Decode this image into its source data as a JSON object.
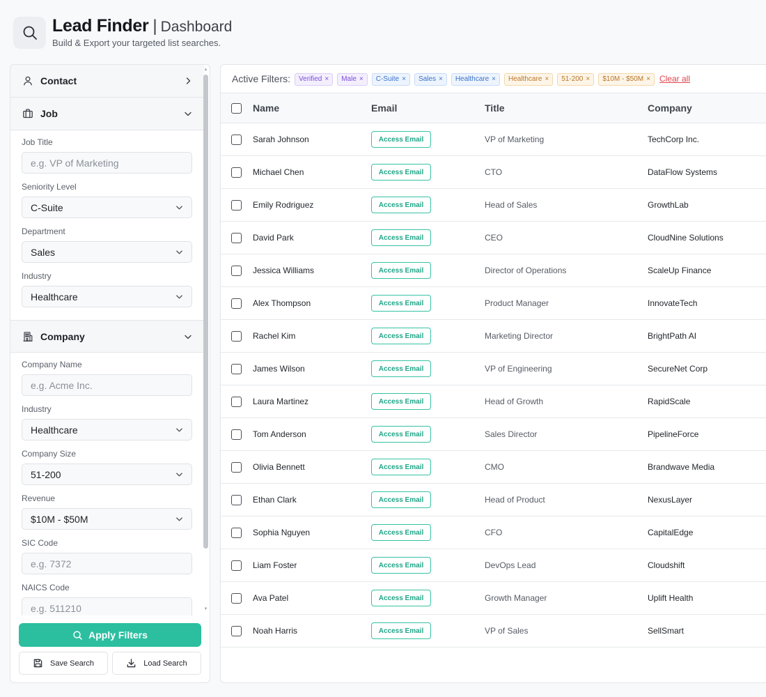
{
  "header": {
    "title": "Lead Finder",
    "separator": "|",
    "section": "Dashboard",
    "subtitle": "Build & Export your targeted list searches."
  },
  "sidebar": {
    "contact_section": {
      "label": "Contact",
      "icon": "user-icon",
      "expanded": false
    },
    "job_section": {
      "label": "Job",
      "icon": "briefcase-icon",
      "expanded": true,
      "job_title_label": "Job Title",
      "job_title_placeholder": "e.g. VP of Marketing",
      "seniority_label": "Seniority Level",
      "seniority_value": "C-Suite",
      "department_label": "Department",
      "department_value": "Sales",
      "industry_label": "Industry",
      "industry_value": "Healthcare"
    },
    "company_section": {
      "label": "Company",
      "icon": "building-icon",
      "expanded": true,
      "company_name_label": "Company Name",
      "company_name_placeholder": "e.g. Acme Inc.",
      "industry_label": "Industry",
      "industry_value": "Healthcare",
      "size_label": "Company Size",
      "size_value": "51-200",
      "revenue_label": "Revenue",
      "revenue_value": "$10M - $50M",
      "sic_label": "SIC Code",
      "sic_placeholder": "e.g. 7372",
      "naics_label": "NAICS Code",
      "naics_placeholder": "e.g. 511210"
    },
    "apply_label": "Apply Filters",
    "save_label": "Save Search",
    "load_label": "Load Search"
  },
  "filters": {
    "label": "Active Filters:",
    "chips": [
      {
        "label": "Verified",
        "color": "purple"
      },
      {
        "label": "Male",
        "color": "purple"
      },
      {
        "label": "C-Suite",
        "color": "blue"
      },
      {
        "label": "Sales",
        "color": "blue"
      },
      {
        "label": "Healthcare",
        "color": "blue"
      },
      {
        "label": "Healthcare",
        "color": "orange"
      },
      {
        "label": "51-200",
        "color": "orange"
      },
      {
        "label": "$10M - $50M",
        "color": "orange"
      }
    ],
    "clear_label": "Clear all"
  },
  "table": {
    "columns": [
      "Name",
      "Email",
      "Title",
      "Company"
    ],
    "access_label": "Access Email",
    "rows": [
      {
        "name": "Sarah Johnson",
        "title": "VP of Marketing",
        "company": "TechCorp Inc."
      },
      {
        "name": "Michael Chen",
        "title": "CTO",
        "company": "DataFlow Systems"
      },
      {
        "name": "Emily Rodriguez",
        "title": "Head of Sales",
        "company": "GrowthLab"
      },
      {
        "name": "David Park",
        "title": "CEO",
        "company": "CloudNine Solutions"
      },
      {
        "name": "Jessica Williams",
        "title": "Director of Operations",
        "company": "ScaleUp Finance"
      },
      {
        "name": "Alex Thompson",
        "title": "Product Manager",
        "company": "InnovateTech"
      },
      {
        "name": "Rachel Kim",
        "title": "Marketing Director",
        "company": "BrightPath AI"
      },
      {
        "name": "James Wilson",
        "title": "VP of Engineering",
        "company": "SecureNet Corp"
      },
      {
        "name": "Laura Martinez",
        "title": "Head of Growth",
        "company": "RapidScale"
      },
      {
        "name": "Tom Anderson",
        "title": "Sales Director",
        "company": "PipelineForce"
      },
      {
        "name": "Olivia Bennett",
        "title": "CMO",
        "company": "Brandwave Media"
      },
      {
        "name": "Ethan Clark",
        "title": "Head of Product",
        "company": "NexusLayer"
      },
      {
        "name": "Sophia Nguyen",
        "title": "CFO",
        "company": "CapitalEdge"
      },
      {
        "name": "Liam Foster",
        "title": "DevOps Lead",
        "company": "Cloudshift"
      },
      {
        "name": "Ava Patel",
        "title": "Growth Manager",
        "company": "Uplift Health"
      },
      {
        "name": "Noah Harris",
        "title": "VP of Sales",
        "company": "SellSmart"
      }
    ]
  },
  "colors": {
    "accent": "#2bbfa0",
    "danger": "#e0434b"
  }
}
